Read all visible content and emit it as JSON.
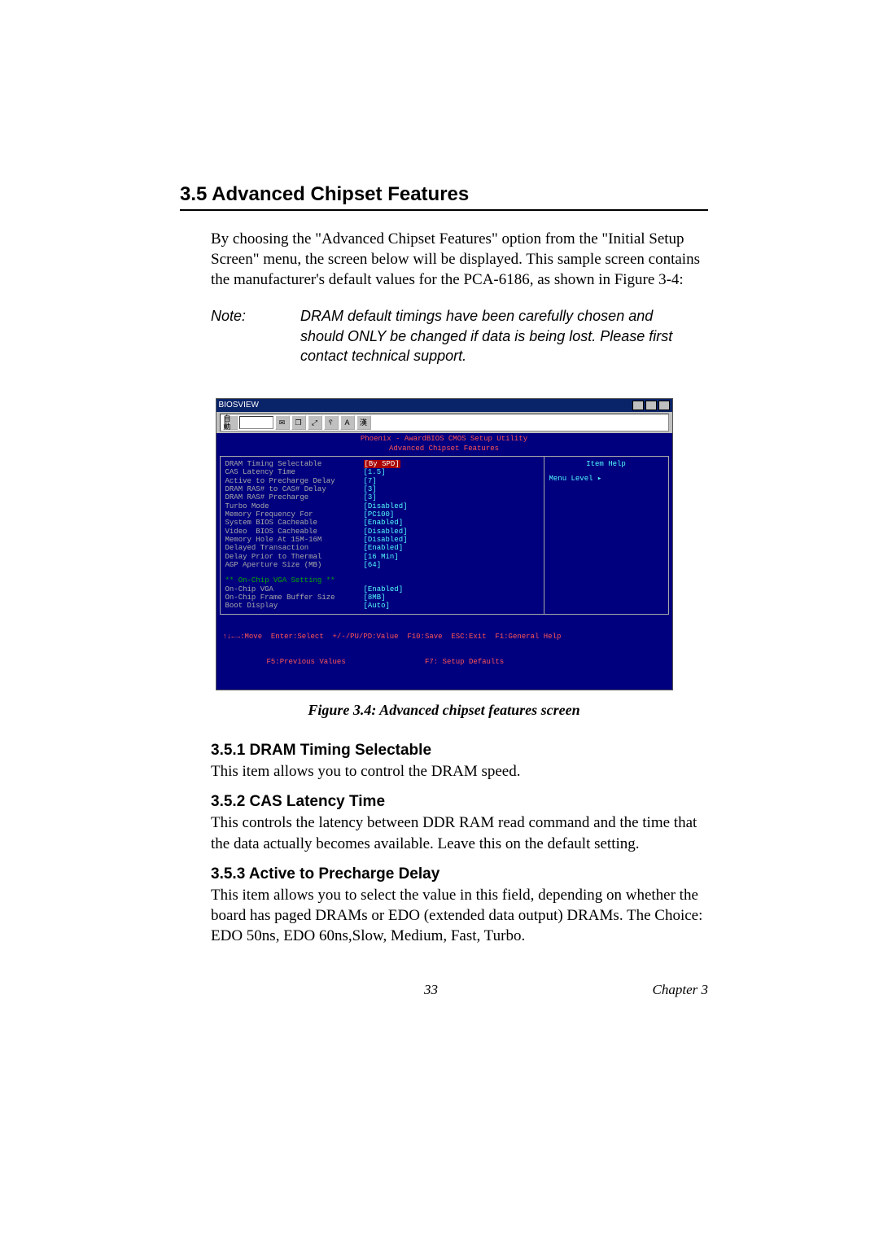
{
  "heading": "3.5  Advanced Chipset Features",
  "intro": "By choosing the \"Advanced Chipset Features\" option from the \"Initial Setup Screen\" menu, the screen below will be displayed. This sample screen contains the manufacturer's default values for the PCA-6186, as shown in Figure 3-4:",
  "note_label": "Note:",
  "note_body": "DRAM default timings have been carefully chosen and should ONLY be changed if data is being lost. Please first contact technical support.",
  "bios": {
    "window_title": "BIOSVIEW",
    "toolbar_label_auto": "自動",
    "toolbar_glyphs": [
      "✉",
      "❐",
      "⤢",
      "␦",
      "A",
      "漢"
    ],
    "headline1": "Phoenix - AwardBIOS CMOS Setup Utility",
    "headline2": "Advanced Chipset Features",
    "rows": [
      {
        "label": "DRAM Timing Selectable",
        "value": "[By SPD]",
        "hl": true
      },
      {
        "label": "CAS Latency Time",
        "value": "[1.5]"
      },
      {
        "label": "Active to Precharge Delay",
        "value": "[7]"
      },
      {
        "label": "DRAM RAS# to CAS# Delay",
        "value": "[3]"
      },
      {
        "label": "DRAM RAS# Precharge",
        "value": "[3]"
      },
      {
        "label": "Turbo Mode",
        "value": "[Disabled]"
      },
      {
        "label": "Memory Frequency For",
        "value": "[PC100]"
      },
      {
        "label": "System BIOS Cacheable",
        "value": "[Enabled]"
      },
      {
        "label": "Video  BIOS Cacheable",
        "value": "[Disabled]"
      },
      {
        "label": "Memory Hole At 15M-16M",
        "value": "[Disabled]"
      },
      {
        "label": "Delayed Transaction",
        "value": "[Enabled]"
      },
      {
        "label": "Delay Prior to Thermal",
        "value": "[16 Min]"
      },
      {
        "label": "AGP Aperture Size (MB)",
        "value": "[64]"
      }
    ],
    "section": "** On-Chip VGA Setting **",
    "rows2": [
      {
        "label": "On-Chip VGA",
        "value": "[Enabled]"
      },
      {
        "label": "On-Chip Frame Buffer Size",
        "value": "[8MB]"
      },
      {
        "label": "Boot Display",
        "value": "[Auto]"
      }
    ],
    "right_head": "Item Help",
    "right_item": "Menu Level   ▸",
    "footer1": "↑↓←→:Move  Enter:Select  +/-/PU/PD:Value  F10:Save  ESC:Exit  F1:General Help",
    "footer2": "          F5:Previous Values                  F7: Setup Defaults"
  },
  "figure_caption": "Figure 3.4: Advanced chipset features screen",
  "sections": [
    {
      "heading": "3.5.1 DRAM Timing Selectable",
      "text": "This item allows you to control the DRAM speed."
    },
    {
      "heading": "3.5.2 CAS Latency Time",
      "text": "This controls the latency between DDR RAM read command and the time that the data actually becomes available. Leave this on the default setting."
    },
    {
      "heading": "3.5.3 Active to Precharge Delay",
      "text": "This item allows you to select the value in this field, depending on whether the board has paged DRAMs or EDO (extended data output) DRAMs. The Choice: EDO 50ns, EDO 60ns,Slow, Medium, Fast, Turbo."
    }
  ],
  "page_number": "33",
  "chapter": "Chapter 3"
}
